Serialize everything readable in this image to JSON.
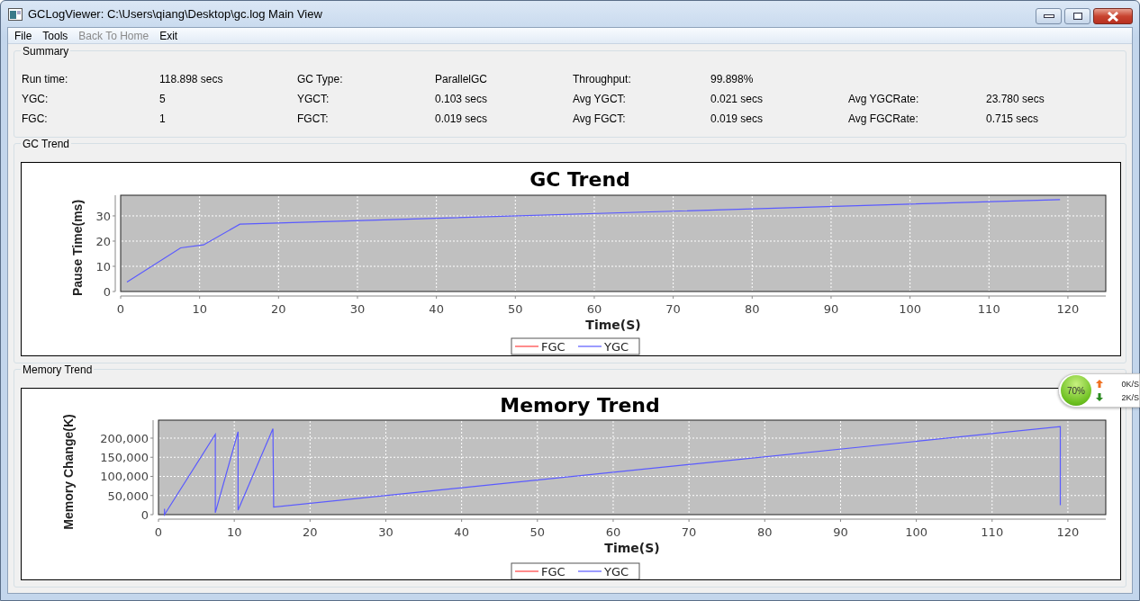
{
  "window": {
    "title": "GCLogViewer: C:\\Users\\qiang\\Desktop\\gc.log Main View"
  },
  "menu": [
    {
      "label": "File",
      "disabled": false
    },
    {
      "label": "Tools",
      "disabled": false
    },
    {
      "label": "Back To Home",
      "disabled": true
    },
    {
      "label": "Exit",
      "disabled": false
    }
  ],
  "summary": {
    "title": "Summary",
    "rows": [
      [
        {
          "label": "Run time:",
          "value": "118.898 secs"
        },
        {
          "label": "GC Type:",
          "value": "ParallelGC"
        },
        {
          "label": "Throughput:",
          "value": "99.898%"
        }
      ],
      [
        {
          "label": "YGC:",
          "value": "5"
        },
        {
          "label": "YGCT:",
          "value": "0.103 secs"
        },
        {
          "label": "Avg YGCT:",
          "value": "0.021 secs"
        },
        {
          "label": "Avg YGCRate:",
          "value": "23.780 secs"
        }
      ],
      [
        {
          "label": "FGC:",
          "value": "1"
        },
        {
          "label": "FGCT:",
          "value": "0.019 secs"
        },
        {
          "label": "Avg FGCT:",
          "value": "0.019 secs"
        },
        {
          "label": "Avg FGCRate:",
          "value": "0.715 secs"
        }
      ]
    ]
  },
  "gc_trend": {
    "title": "GC Trend",
    "chart_data": {
      "type": "line",
      "title": "GC Trend",
      "xlabel": "Time(S)",
      "ylabel": "Pause Time(ms)",
      "x": [
        0.8,
        7.6,
        10.5,
        15.1,
        119
      ],
      "series": [
        {
          "name": "FGC",
          "color": "#ff4040",
          "values": [
            null,
            null,
            null,
            null,
            null
          ]
        },
        {
          "name": "YGC",
          "color": "#5a5aff",
          "values": [
            3.8,
            17.3,
            18.5,
            26.7,
            36.5
          ]
        }
      ],
      "grid": true,
      "xlim": [
        0,
        124.8
      ],
      "ylim": [
        0,
        38.2
      ],
      "xticks": [
        0,
        10,
        20,
        30,
        40,
        50,
        60,
        70,
        80,
        90,
        100,
        110,
        120
      ],
      "yticks": [
        0,
        10,
        20,
        30
      ]
    }
  },
  "memory_trend": {
    "title": "Memory Trend",
    "chart_data": {
      "type": "line",
      "title": "Memory Trend",
      "xlabel": "Time(S)",
      "ylabel": "Memory Change(K)",
      "x": [
        0.8,
        0.8,
        7.5,
        7.5,
        10.5,
        10.5,
        15.1,
        15.2,
        119,
        119
      ],
      "series": [
        {
          "name": "FGC",
          "color": "#ff4040",
          "values": [
            null,
            null,
            null,
            null,
            null,
            null,
            null,
            null,
            null,
            null
          ]
        },
        {
          "name": "YGC",
          "color": "#5a5aff",
          "values": [
            15000,
            0,
            210000,
            5000,
            217000,
            12000,
            225000,
            20000,
            230000,
            25000
          ]
        }
      ],
      "grid": true,
      "xlim": [
        0,
        125
      ],
      "ylim": [
        0,
        247000
      ],
      "xticks": [
        0,
        10,
        20,
        30,
        40,
        50,
        60,
        70,
        80,
        90,
        100,
        110,
        120
      ],
      "yticks": [
        {
          "value": 0,
          "label": "0"
        },
        {
          "value": 50000,
          "label": "50,000"
        },
        {
          "value": 100000,
          "label": "100,000"
        },
        {
          "value": 150000,
          "label": "150,000"
        },
        {
          "value": 200000,
          "label": "200,000"
        }
      ]
    }
  },
  "network_widget": {
    "percent": "70%",
    "upload": "0K/S",
    "download": "2K/S"
  }
}
